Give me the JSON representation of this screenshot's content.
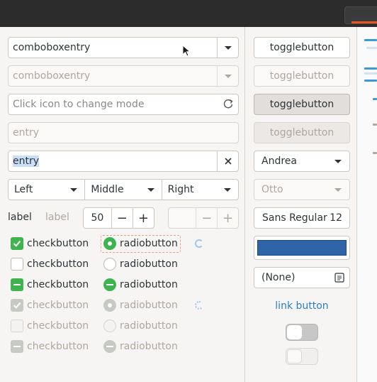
{
  "combo_entry": {
    "value": "comboboxentry"
  },
  "combo_entry_disabled": {
    "value": "comboboxentry"
  },
  "icon_entry": {
    "placeholder": "Click icon to change mode"
  },
  "entry_disabled": {
    "value": "entry"
  },
  "entry_selected": {
    "value": "entry"
  },
  "alignment_combos": [
    "Left",
    "Middle",
    "Right"
  ],
  "labels": {
    "label1": "label",
    "label2": "label"
  },
  "spin": {
    "value": "50",
    "minus": "−",
    "plus": "+",
    "disabled_minus": "−",
    "disabled_plus": "+"
  },
  "checkbuttons": [
    {
      "label": "checkbutton",
      "state": "checked"
    },
    {
      "label": "checkbutton",
      "state": "unchecked"
    },
    {
      "label": "checkbutton",
      "state": "inconsistent"
    },
    {
      "label": "checkbutton",
      "state": "checked-disabled"
    },
    {
      "label": "checkbutton",
      "state": "unchecked-disabled"
    },
    {
      "label": "checkbutton",
      "state": "inconsistent-disabled"
    }
  ],
  "radiobuttons": [
    {
      "label": "radiobutton",
      "state": "checked"
    },
    {
      "label": "radiobutton",
      "state": "unchecked"
    },
    {
      "label": "radiobutton",
      "state": "inconsistent"
    },
    {
      "label": "radiobutton",
      "state": "checked-disabled"
    },
    {
      "label": "radiobutton",
      "state": "unchecked-disabled"
    },
    {
      "label": "radiobutton",
      "state": "inconsistent-disabled"
    }
  ],
  "togglebuttons": [
    {
      "label": "togglebutton",
      "state": "normal"
    },
    {
      "label": "togglebutton",
      "state": "disabled"
    },
    {
      "label": "togglebutton",
      "state": "pressed"
    },
    {
      "label": "togglebutton",
      "state": "pressed-disabled"
    }
  ],
  "name_combo": {
    "value": "Andrea"
  },
  "name_combo_disabled": {
    "value": "Otto"
  },
  "font_button": {
    "family": "Sans Regular",
    "size": "12"
  },
  "color_button": {
    "color": "#2f65a8"
  },
  "file_button": {
    "value": "(None)"
  },
  "link_button": {
    "label": "link button"
  },
  "switches": [
    {
      "state": "off"
    },
    {
      "state": "off-disabled"
    }
  ],
  "colors": {
    "accent_green": "#3eb34f",
    "link_blue": "#2a7ec4",
    "titlebar_accent": "#e95420"
  }
}
